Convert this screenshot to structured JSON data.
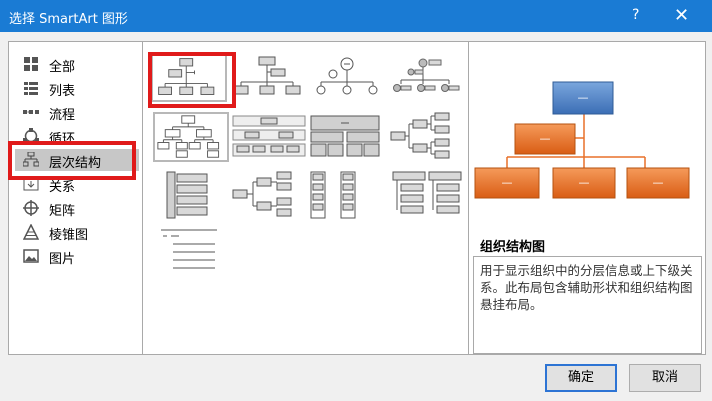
{
  "window": {
    "title": "选择 SmartArt 图形",
    "help_label": "?",
    "close_label": "✕"
  },
  "categories": [
    {
      "label": "全部",
      "icon": "grid-icon"
    },
    {
      "label": "列表",
      "icon": "list-icon"
    },
    {
      "label": "流程",
      "icon": "process-icon"
    },
    {
      "label": "循环",
      "icon": "cycle-icon"
    },
    {
      "label": "层次结构",
      "icon": "hierarchy-icon",
      "selected": true
    },
    {
      "label": "关系",
      "icon": "relationship-icon"
    },
    {
      "label": "矩阵",
      "icon": "matrix-icon"
    },
    {
      "label": "棱锥图",
      "icon": "pyramid-icon"
    },
    {
      "label": "图片",
      "icon": "picture-icon"
    }
  ],
  "preview": {
    "title": "组织结构图",
    "description": "用于显示组织中的分层信息或上下级关系。此布局包含辅助形状和组织结构图悬挂布局。",
    "box_label": "—"
  },
  "buttons": {
    "ok": "确定",
    "cancel": "取消"
  },
  "colors": {
    "titlebar": "#1a7bd4",
    "selection_highlight": "#e01a1a",
    "preview_top": "#4a7fc1",
    "preview_orange": "#e8702a"
  }
}
